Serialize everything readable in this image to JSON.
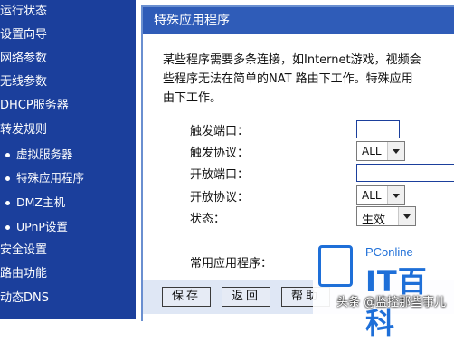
{
  "sidebar": {
    "items": [
      {
        "label": "运行状态",
        "sub": false
      },
      {
        "label": "设置向导",
        "sub": false
      },
      {
        "label": "网络参数",
        "sub": false
      },
      {
        "label": "无线参数",
        "sub": false
      },
      {
        "label": "DHCP服务器",
        "sub": false
      },
      {
        "label": "转发规则",
        "sub": false
      },
      {
        "label": "虚拟服务器",
        "sub": true
      },
      {
        "label": "特殊应用程序",
        "sub": true
      },
      {
        "label": "DMZ主机",
        "sub": true
      },
      {
        "label": "UPnP设置",
        "sub": true
      },
      {
        "label": "安全设置",
        "sub": false
      },
      {
        "label": "路由功能",
        "sub": false
      },
      {
        "label": "动态DNS",
        "sub": false
      }
    ]
  },
  "panel": {
    "title": "特殊应用程序",
    "desc_lines": [
      "某些程序需要多条连接，如Internet游戏，视频会",
      "些程序无法在简单的NAT 路由下工作。特殊应用",
      "由下工作。"
    ]
  },
  "form": {
    "trigger_port_label": "触发端口：",
    "trigger_port_value": "",
    "trigger_protocol_label": "触发协议：",
    "trigger_protocol_value": "ALL",
    "open_port_label": "开放端口：",
    "open_port_value": "",
    "open_protocol_label": "开放协议：",
    "open_protocol_value": "ALL",
    "status_label": "状态：",
    "status_value": "生效",
    "common_apps_label": "常用应用程序："
  },
  "buttons": {
    "save": "保存",
    "back": "返回",
    "help": "帮助"
  },
  "watermark": {
    "brand": "PConline",
    "big": "IT百科",
    "caption": "头条 @监控那些事儿"
  }
}
